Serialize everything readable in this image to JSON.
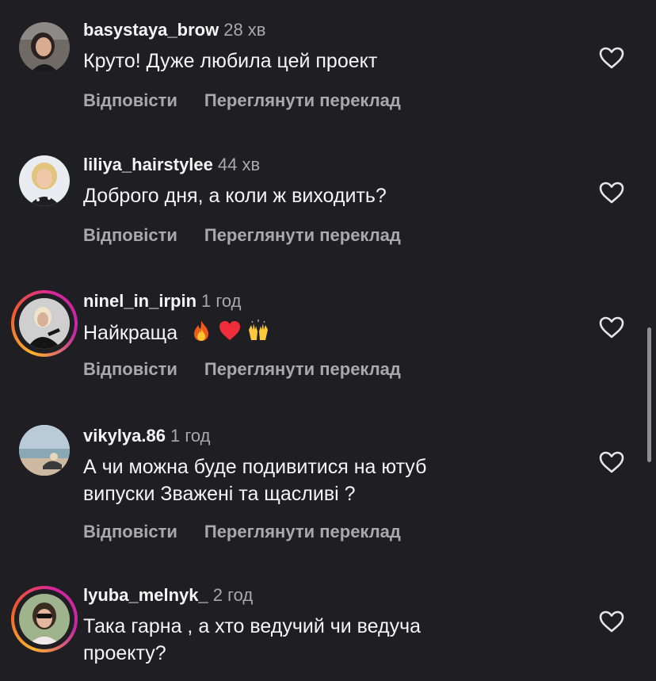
{
  "colors": {
    "background": "#1f1f23",
    "text_primary": "#f5f5f5",
    "text_secondary": "#a8a8ad",
    "story_ring_start": "#f9b32d",
    "story_ring_end": "#d6249f"
  },
  "comments": [
    {
      "username": "basystaya_brow",
      "time": "28 хв",
      "text_lines": [
        "Круто! Дуже любила цей проект"
      ],
      "has_story_ring": false,
      "avatar": "avatar-woman-dark-hair",
      "reply_label": "Відповісти",
      "translate_label": "Переглянути переклад",
      "like_icon": "heart-outline-icon"
    },
    {
      "username": "liliya_hairstylee",
      "time": "44 хв",
      "text_lines": [
        "Доброго дня, а коли ж виходить?"
      ],
      "has_story_ring": false,
      "avatar": "avatar-woman-blonde",
      "reply_label": "Відповісти",
      "translate_label": "Переглянути переклад",
      "like_icon": "heart-outline-icon"
    },
    {
      "username": "ninel_in_irpin",
      "time": "1 год",
      "text_lines": [
        "Найкраща"
      ],
      "emojis": [
        "fire-emoji",
        "red-heart-emoji",
        "raising-hands-emoji"
      ],
      "has_story_ring": true,
      "avatar": "avatar-woman-black-outfit",
      "reply_label": "Відповісти",
      "translate_label": "Переглянути переклад",
      "like_icon": "heart-outline-icon"
    },
    {
      "username": "vikylya.86",
      "time": "1 год",
      "text_lines": [
        "А чи можна буде подивитися на ютуб",
        "випуски Зважені та щасливі ?"
      ],
      "has_story_ring": false,
      "avatar": "avatar-beach",
      "reply_label": "Відповісти",
      "translate_label": "Переглянути переклад",
      "like_icon": "heart-outline-icon"
    },
    {
      "username": "lyuba_melnyk_",
      "time": "2 год",
      "text_lines": [
        "Така гарна , а хто ведучий чи ведуча",
        "проекту?"
      ],
      "has_story_ring": true,
      "avatar": "avatar-woman-sunglasses",
      "like_icon": "heart-outline-icon"
    }
  ]
}
